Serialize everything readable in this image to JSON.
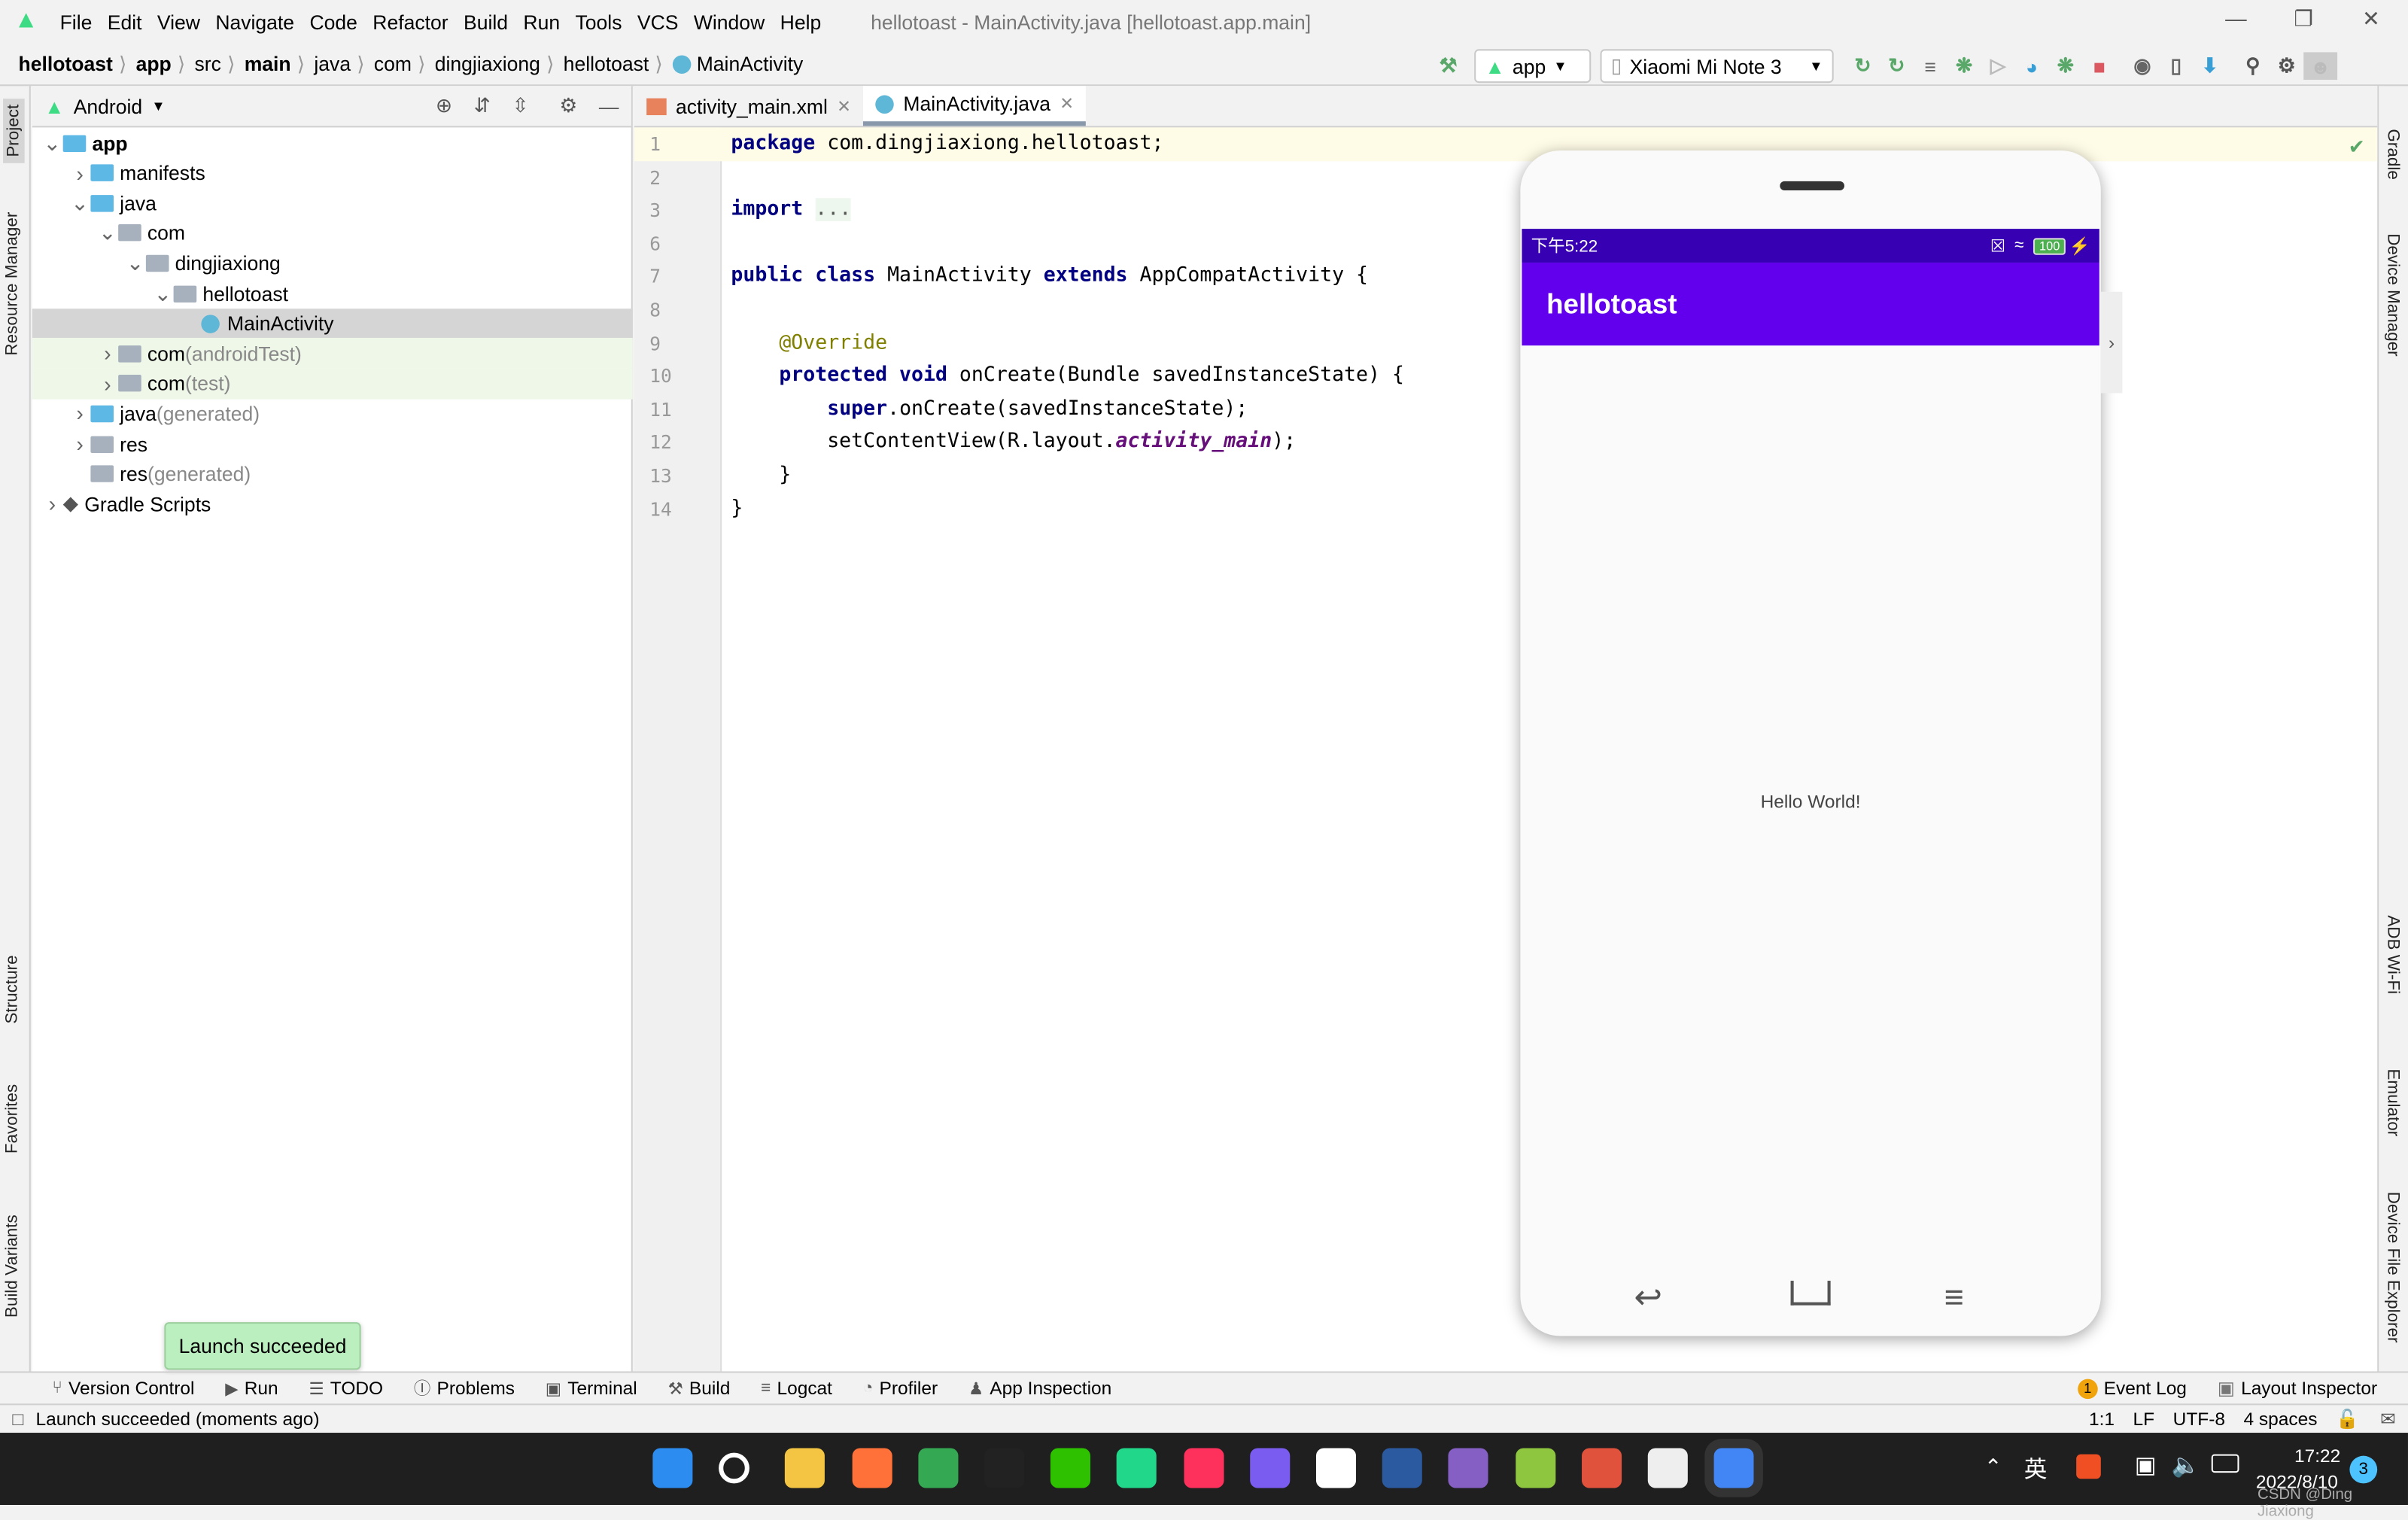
{
  "window": {
    "title": "hellotoast - MainActivity.java [hellotoast.app.main]"
  },
  "menu": [
    "File",
    "Edit",
    "View",
    "Navigate",
    "Code",
    "Refactor",
    "Build",
    "Run",
    "Tools",
    "VCS",
    "Window",
    "Help"
  ],
  "breadcrumb": [
    "hellotoast",
    "app",
    "src",
    "main",
    "java",
    "com",
    "dingjiaxiong",
    "hellotoast",
    "MainActivity"
  ],
  "toolbar": {
    "config": "app",
    "device": "Xiaomi Mi Note 3"
  },
  "left_tabs": [
    "Project",
    "Resource Manager",
    "Structure",
    "Favorites",
    "Build Variants"
  ],
  "right_tabs": [
    "Gradle",
    "Device Manager",
    "ADB Wi-Fi",
    "Emulator",
    "Device File Explorer"
  ],
  "project": {
    "view": "Android",
    "tree": [
      {
        "label": "app",
        "suffix": "",
        "level": 0,
        "arrow": "down",
        "icon": "folder",
        "bold": true
      },
      {
        "label": "manifests",
        "suffix": "",
        "level": 1,
        "arrow": "right",
        "icon": "folder"
      },
      {
        "label": "java",
        "suffix": "",
        "level": 1,
        "arrow": "down",
        "icon": "folder"
      },
      {
        "label": "com",
        "suffix": "",
        "level": 2,
        "arrow": "down",
        "icon": "package"
      },
      {
        "label": "dingjiaxiong",
        "suffix": "",
        "level": 3,
        "arrow": "down",
        "icon": "package"
      },
      {
        "label": "hellotoast",
        "suffix": "",
        "level": 4,
        "arrow": "down",
        "icon": "package"
      },
      {
        "label": "MainActivity",
        "suffix": "",
        "level": 5,
        "arrow": "",
        "icon": "class",
        "selected": true
      },
      {
        "label": "com",
        "suffix": " (androidTest)",
        "level": 2,
        "arrow": "right",
        "icon": "package",
        "test": true
      },
      {
        "label": "com",
        "suffix": " (test)",
        "level": 2,
        "arrow": "right",
        "icon": "package",
        "test": true
      },
      {
        "label": "java",
        "suffix": " (generated)",
        "level": 1,
        "arrow": "right",
        "icon": "folder-gen"
      },
      {
        "label": "res",
        "suffix": "",
        "level": 1,
        "arrow": "right",
        "icon": "res"
      },
      {
        "label": "res",
        "suffix": " (generated)",
        "level": 1,
        "arrow": "",
        "icon": "res"
      },
      {
        "label": "Gradle Scripts",
        "suffix": "",
        "level": 0,
        "arrow": "right",
        "icon": "gradle"
      }
    ]
  },
  "editor": {
    "tabs": [
      {
        "label": "activity_main.xml",
        "active": false
      },
      {
        "label": "MainActivity.java",
        "active": true
      }
    ],
    "lines": [
      {
        "n": "1",
        "t": [
          [
            "package",
            "kw"
          ],
          [
            " com.dingjiaxiong.hellotoast;",
            ""
          ]
        ]
      },
      {
        "n": "2",
        "t": []
      },
      {
        "n": "3",
        "t": [
          [
            "import",
            "kw"
          ],
          [
            " ",
            ""
          ],
          [
            "...",
            "fo"
          ]
        ]
      },
      {
        "n": "6",
        "t": []
      },
      {
        "n": "7",
        "t": [
          [
            "public class",
            "kw"
          ],
          [
            " MainActivity ",
            ""
          ],
          [
            "extends",
            "kw"
          ],
          [
            " AppCompatActivity {",
            ""
          ]
        ]
      },
      {
        "n": "8",
        "t": []
      },
      {
        "n": "9",
        "t": [
          [
            "    ",
            ""
          ],
          [
            "@Override",
            "ann"
          ]
        ]
      },
      {
        "n": "10",
        "t": [
          [
            "    ",
            ""
          ],
          [
            "protected void",
            "kw"
          ],
          [
            " onCreate(Bundle savedInstanceState) {",
            ""
          ]
        ]
      },
      {
        "n": "11",
        "t": [
          [
            "        ",
            ""
          ],
          [
            "super",
            "kw"
          ],
          [
            ".onCreate(savedInstanceState);",
            ""
          ]
        ]
      },
      {
        "n": "12",
        "t": [
          [
            "        setContentView(R.layout.",
            ""
          ],
          [
            "activity_main",
            "it"
          ],
          [
            ");",
            ""
          ]
        ]
      },
      {
        "n": "13",
        "t": [
          [
            "    }",
            ""
          ]
        ]
      },
      {
        "n": "14",
        "t": [
          [
            "}",
            ""
          ]
        ]
      }
    ]
  },
  "emulator": {
    "time": "下午5:22",
    "battery": "100",
    "app_title": "hellotoast",
    "content": "Hello World!",
    "colors": {
      "status": "#3700b3",
      "appbar": "#6200ee"
    }
  },
  "toast": "Launch succeeded",
  "bottom_tools": [
    "Version Control",
    "Run",
    "TODO",
    "Problems",
    "Terminal",
    "Build",
    "Logcat",
    "Profiler",
    "App Inspection"
  ],
  "bottom_right": {
    "event_count": "1",
    "event_log": "Event Log",
    "layout_inspector": "Layout Inspector"
  },
  "status": {
    "message": "Launch succeeded (moments ago)",
    "position": "1:1",
    "line_sep": "LF",
    "encoding": "UTF-8",
    "indent": "4 spaces"
  },
  "taskbar": {
    "ime": "英",
    "time": "17:22",
    "date": "2022/8/10",
    "notifications": "3",
    "watermark": "CSDN @Ding Jiaxiong",
    "apps": [
      {
        "name": "windows-start",
        "color": "#2d8cf0"
      },
      {
        "name": "search",
        "color": "#1f1f1f"
      },
      {
        "name": "file-explorer",
        "color": "#f4c542"
      },
      {
        "name": "firefox",
        "color": "#ff7139"
      },
      {
        "name": "chrome",
        "color": "#34a853"
      },
      {
        "name": "qq",
        "color": "#222"
      },
      {
        "name": "wechat",
        "color": "#2dc100"
      },
      {
        "name": "pycharm",
        "color": "#21d789"
      },
      {
        "name": "intellij",
        "color": "#fe315d"
      },
      {
        "name": "goland",
        "color": "#7b5cf0"
      },
      {
        "name": "app-w",
        "color": "#ffffff"
      },
      {
        "name": "devcpp",
        "color": "#2c5aa0"
      },
      {
        "name": "visual-studio",
        "color": "#865fc5"
      },
      {
        "name": "notepad",
        "color": "#8ec63f"
      },
      {
        "name": "app-swirl",
        "color": "#e0523c"
      },
      {
        "name": "typora",
        "color": "#eeeeee"
      },
      {
        "name": "android-studio",
        "color": "#4285f4"
      }
    ]
  }
}
